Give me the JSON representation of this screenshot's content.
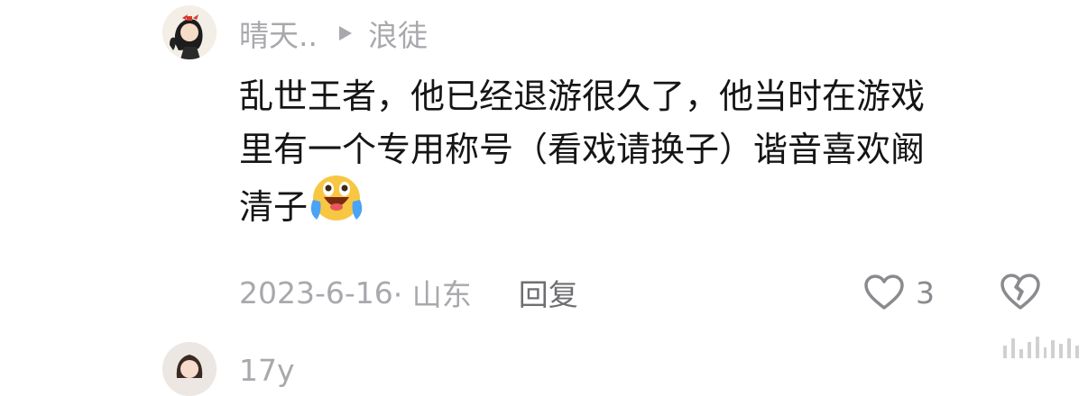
{
  "comment": {
    "author": "晴天..",
    "reply_to": "浪徒",
    "lines": [
      "乱世王者，他已经退游很久了，他当时在游戏",
      "里有一个专用称号（看戏请换子）谐音喜欢阚",
      "清子"
    ],
    "emoji": "crying-laughing-emoji",
    "date": "2023-6-16",
    "location": "· 山东",
    "reply_label": "回复",
    "like_count": "3"
  },
  "next_comment": {
    "author": "17y"
  },
  "colors": {
    "text": "#151515",
    "muted": "#a8a8ad",
    "emoji_yellow": "#f7c744",
    "tear_blue": "#4aa3f5"
  }
}
